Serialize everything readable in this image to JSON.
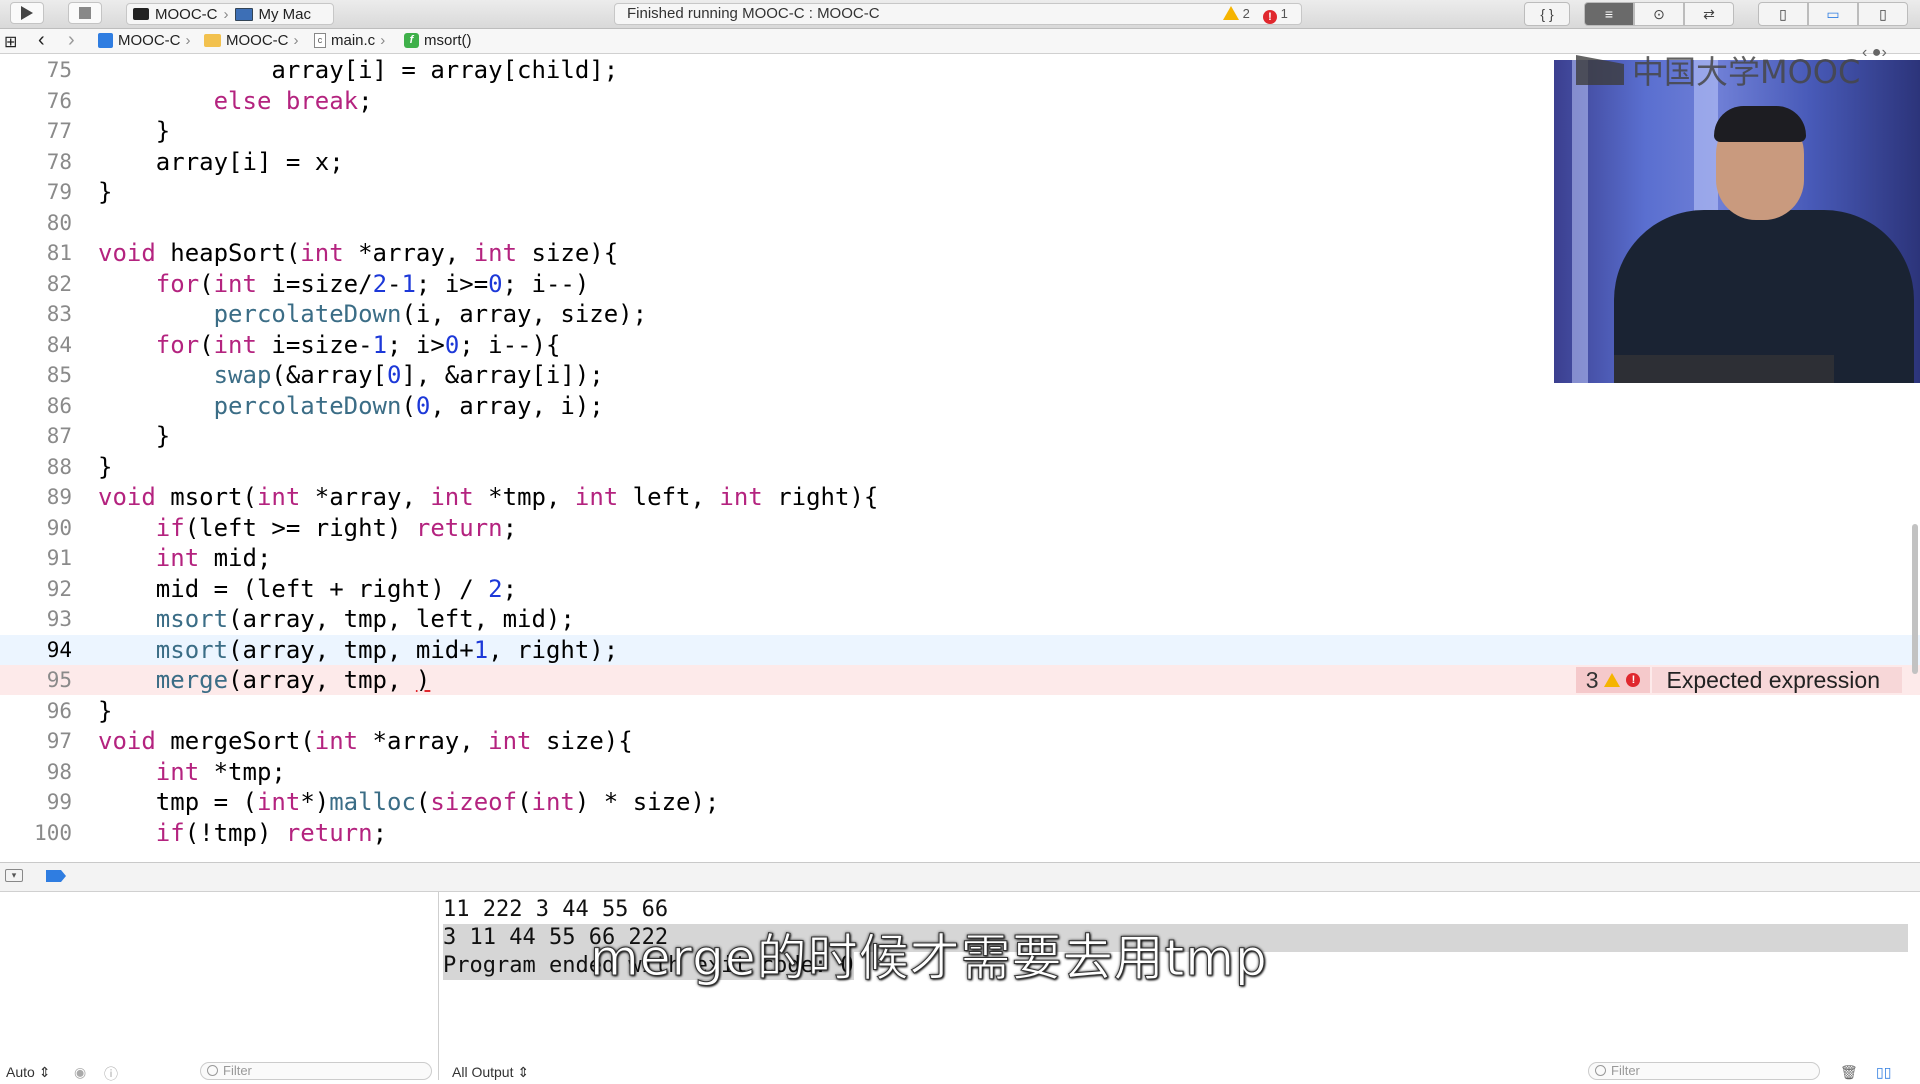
{
  "toolbar": {
    "run_icon": "play-icon",
    "stop_icon": "stop-icon",
    "scheme_target": "MOOC-C",
    "scheme_device": "My Mac",
    "scheme_separator": "›",
    "status_text": "Finished running MOOC-C : MOOC-C",
    "warning_count": "2",
    "error_count": "1",
    "right_buttons": [
      "{ }",
      "≡",
      "⊙",
      "⇄",
      "▯",
      "▭",
      "▯"
    ]
  },
  "jumpbar": {
    "grid": "⊞",
    "back": "‹",
    "forward": "›",
    "crumbs": [
      "MOOC-C",
      "MOOC-C",
      "main.c",
      "msort()"
    ],
    "separator": "›",
    "nav_right": "‹ ●›"
  },
  "editor": {
    "lines": [
      {
        "n": "75",
        "code": [
          [
            "",
            "            array[i] = array[child];"
          ]
        ]
      },
      {
        "n": "76",
        "code": [
          [
            "",
            "        "
          ],
          [
            "k",
            "else"
          ],
          [
            "",
            " "
          ],
          [
            "k",
            "break"
          ],
          [
            "",
            ";"
          ]
        ]
      },
      {
        "n": "77",
        "code": [
          [
            "",
            "    }"
          ]
        ]
      },
      {
        "n": "78",
        "code": [
          [
            "",
            "    array[i] = x;"
          ]
        ]
      },
      {
        "n": "79",
        "code": [
          [
            "",
            "}"
          ]
        ]
      },
      {
        "n": "80",
        "code": [
          [
            "",
            ""
          ]
        ]
      },
      {
        "n": "81",
        "code": [
          [
            "k",
            "void"
          ],
          [
            "",
            " heapSort("
          ],
          [
            "k",
            "int"
          ],
          [
            "",
            " *array, "
          ],
          [
            "k",
            "int"
          ],
          [
            "",
            " size){"
          ]
        ]
      },
      {
        "n": "82",
        "code": [
          [
            "",
            "    "
          ],
          [
            "k",
            "for"
          ],
          [
            "",
            "("
          ],
          [
            "k",
            "int"
          ],
          [
            "",
            " i=size/"
          ],
          [
            "n",
            "2"
          ],
          [
            "",
            "-"
          ],
          [
            "n",
            "1"
          ],
          [
            "",
            "; i>="
          ],
          [
            "n",
            "0"
          ],
          [
            "",
            "; i--)"
          ]
        ]
      },
      {
        "n": "83",
        "code": [
          [
            "",
            "        "
          ],
          [
            "f",
            "percolateDown"
          ],
          [
            "",
            "(i, array, size);"
          ]
        ]
      },
      {
        "n": "84",
        "code": [
          [
            "",
            "    "
          ],
          [
            "k",
            "for"
          ],
          [
            "",
            "("
          ],
          [
            "k",
            "int"
          ],
          [
            "",
            " i=size-"
          ],
          [
            "n",
            "1"
          ],
          [
            "",
            "; i>"
          ],
          [
            "n",
            "0"
          ],
          [
            "",
            "; i--){"
          ]
        ]
      },
      {
        "n": "85",
        "code": [
          [
            "",
            "        "
          ],
          [
            "f",
            "swap"
          ],
          [
            "",
            "(&array["
          ],
          [
            "n",
            "0"
          ],
          [
            "",
            "], &array[i]);"
          ]
        ]
      },
      {
        "n": "86",
        "code": [
          [
            "",
            "        "
          ],
          [
            "f",
            "percolateDown"
          ],
          [
            "",
            "("
          ],
          [
            "n",
            "0"
          ],
          [
            "",
            ", array, i);"
          ]
        ]
      },
      {
        "n": "87",
        "code": [
          [
            "",
            "    }"
          ]
        ]
      },
      {
        "n": "88",
        "code": [
          [
            "",
            "}"
          ]
        ]
      },
      {
        "n": "89",
        "code": [
          [
            "k",
            "void"
          ],
          [
            "",
            " msort("
          ],
          [
            "k",
            "int"
          ],
          [
            "",
            " *array, "
          ],
          [
            "k",
            "int"
          ],
          [
            "",
            " *tmp, "
          ],
          [
            "k",
            "int"
          ],
          [
            "",
            " left, "
          ],
          [
            "k",
            "int"
          ],
          [
            "",
            " right){"
          ]
        ]
      },
      {
        "n": "90",
        "code": [
          [
            "",
            "    "
          ],
          [
            "k",
            "if"
          ],
          [
            "",
            "(left >= right) "
          ],
          [
            "k",
            "return"
          ],
          [
            "",
            ";"
          ]
        ]
      },
      {
        "n": "91",
        "code": [
          [
            "",
            "    "
          ],
          [
            "k",
            "int"
          ],
          [
            "",
            " mid;"
          ]
        ]
      },
      {
        "n": "92",
        "code": [
          [
            "",
            "    mid = (left + right) / "
          ],
          [
            "n",
            "2"
          ],
          [
            "",
            ";"
          ]
        ]
      },
      {
        "n": "93",
        "code": [
          [
            "",
            "    "
          ],
          [
            "f",
            "msort"
          ],
          [
            "",
            "(array, tmp, left, mid);"
          ]
        ]
      },
      {
        "n": "94",
        "current": true,
        "code": [
          [
            "",
            "    "
          ],
          [
            "f",
            "msort"
          ],
          [
            "",
            "(array, tmp, mid+"
          ],
          [
            "n",
            "1"
          ],
          [
            "",
            ", right);"
          ]
        ]
      },
      {
        "n": "95",
        "error": true,
        "code": [
          [
            "",
            "    "
          ],
          [
            "f",
            "merge"
          ],
          [
            "",
            "(array, tmp, "
          ],
          [
            "errsq",
            ")"
          ]
        ]
      },
      {
        "n": "96",
        "code": [
          [
            "",
            "}"
          ]
        ]
      },
      {
        "n": "97",
        "code": [
          [
            "k",
            "void"
          ],
          [
            "",
            " mergeSort("
          ],
          [
            "k",
            "int"
          ],
          [
            "",
            " *array, "
          ],
          [
            "k",
            "int"
          ],
          [
            "",
            " size){"
          ]
        ]
      },
      {
        "n": "98",
        "code": [
          [
            "",
            "    "
          ],
          [
            "k",
            "int"
          ],
          [
            "",
            " *tmp;"
          ]
        ]
      },
      {
        "n": "99",
        "code": [
          [
            "",
            "    tmp = ("
          ],
          [
            "k",
            "int"
          ],
          [
            "",
            "*)"
          ],
          [
            "f",
            "malloc"
          ],
          [
            "",
            "("
          ],
          [
            "k",
            "sizeof"
          ],
          [
            "",
            "("
          ],
          [
            "k",
            "int"
          ],
          [
            "",
            ") * size);"
          ]
        ]
      },
      {
        "n": "100",
        "code": [
          [
            "",
            "    "
          ],
          [
            "k",
            "if"
          ],
          [
            "",
            "(!tmp) "
          ],
          [
            "k",
            "return"
          ],
          [
            "",
            ";"
          ]
        ]
      }
    ],
    "issue": {
      "count": "3",
      "message": "Expected expression"
    }
  },
  "video": {
    "logo_text": "中国大学MOOC"
  },
  "console": {
    "lines": [
      "11 222 3 44 55 66",
      "3 11 44 55 66 222",
      "Program ended with exit code: 0"
    ],
    "subtitle": "merge的时候才需要去用tmp"
  },
  "bottombar": {
    "auto_label": "Auto ⇕",
    "left_filter_placeholder": "Filter",
    "output_select": "All Output ⇕",
    "right_filter_placeholder": "Filter"
  }
}
